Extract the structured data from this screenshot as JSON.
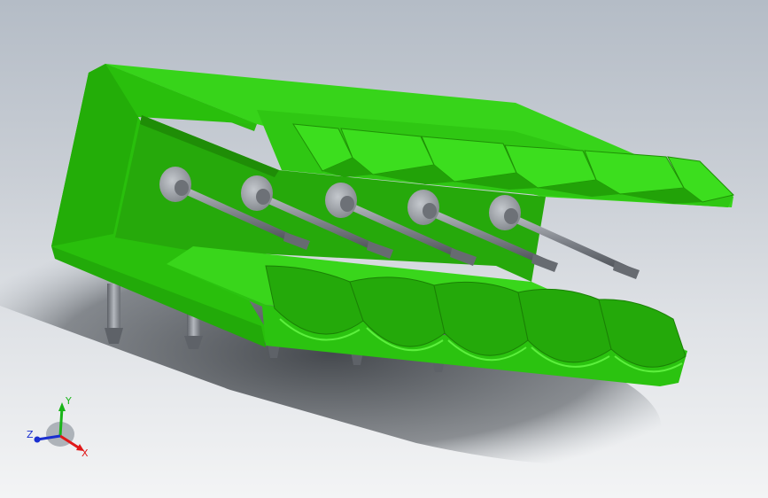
{
  "view": {
    "triad": {
      "x_label": "X",
      "y_label": "Y",
      "z_label": "Z",
      "x_color": "#e01818",
      "y_color": "#18b418",
      "z_color": "#1a2fd0"
    }
  },
  "model": {
    "body_color": "#2ecc0f",
    "pin_color": "#8c9096",
    "pin_count": 5
  }
}
